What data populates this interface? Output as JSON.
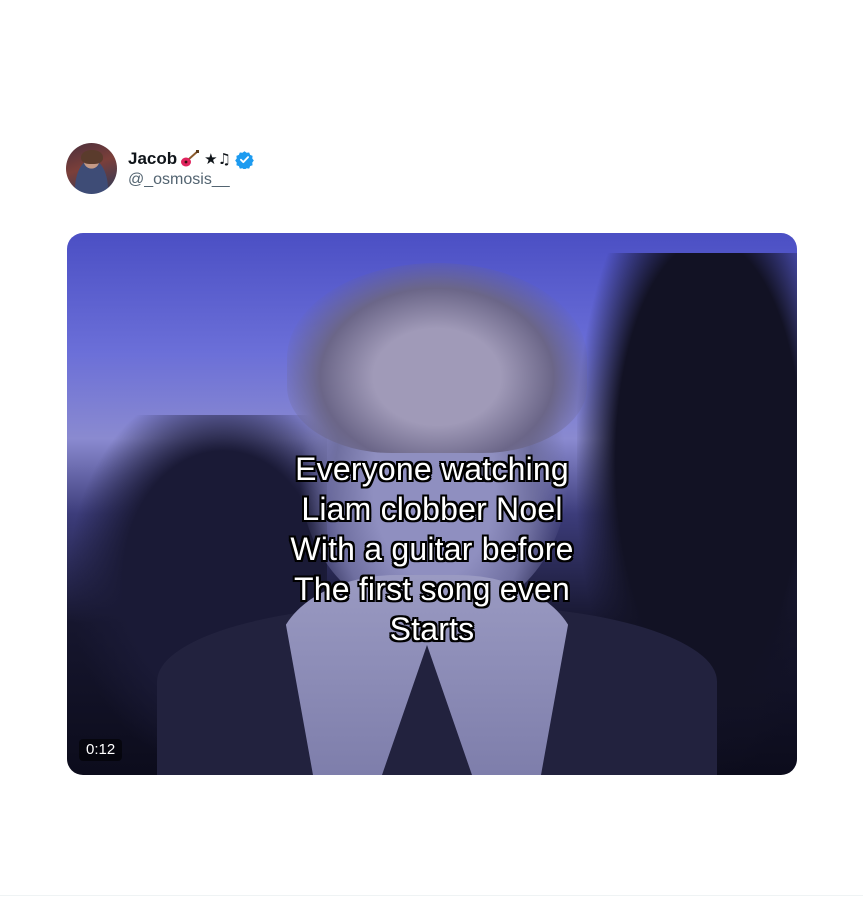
{
  "tweet": {
    "author": {
      "display_name": "Jacob",
      "name_emoji": "★♫",
      "handle": "@_osmosis__",
      "verified": true,
      "icons": [
        "guitar-icon",
        "verified-badge-icon"
      ]
    },
    "media": {
      "type": "video",
      "duration": "0:12",
      "caption_lines": [
        "Everyone watching",
        "Liam clobber Noel",
        "With a guitar before",
        "The first song even",
        "Starts"
      ]
    }
  },
  "colors": {
    "verified_blue": "#1d9bf0",
    "name_text": "#0f1419",
    "handle_text": "#536471",
    "guitar_red": "#e0245e"
  }
}
